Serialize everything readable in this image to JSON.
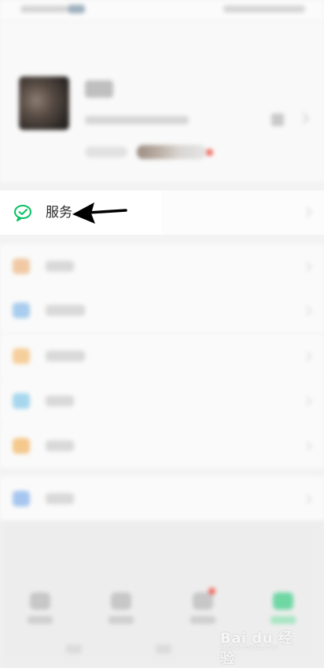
{
  "service": {
    "label": "服务"
  },
  "menu": {
    "items": [
      {
        "icon": "favorites-icon",
        "color": "#f0c9a4"
      },
      {
        "icon": "moments-icon",
        "color": "#a9cdee"
      },
      {
        "icon": "wallet-icon",
        "color": "#f5cf9b"
      },
      {
        "icon": "cards-icon",
        "color": "#a7d7ee"
      },
      {
        "icon": "stickers-icon",
        "color": "#f5c88c"
      },
      {
        "icon": "settings-icon",
        "color": "#a7c6ef"
      }
    ]
  },
  "tabs": [
    {
      "icon": "chats-icon",
      "active": false
    },
    {
      "icon": "contacts-icon",
      "active": false
    },
    {
      "icon": "discover-icon",
      "active": false,
      "badge": true
    },
    {
      "icon": "me-icon",
      "active": true
    }
  ],
  "watermark": {
    "text": "Bai du 经验",
    "sub": "jingyan.baidu.com"
  },
  "colors": {
    "accent": "#07c160",
    "arrow": "#000000"
  }
}
